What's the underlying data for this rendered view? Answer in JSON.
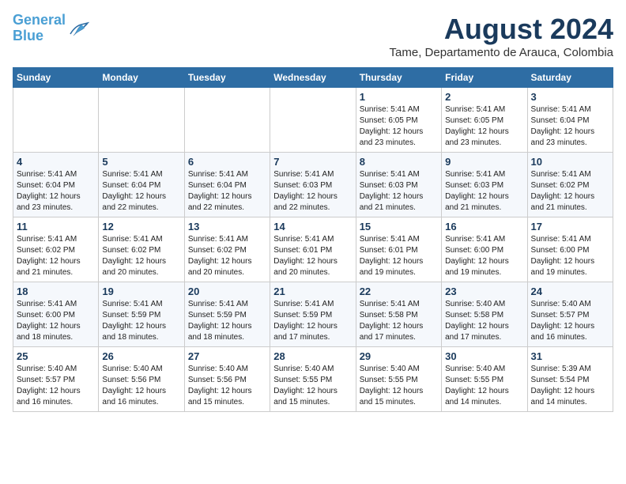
{
  "header": {
    "logo_line1": "General",
    "logo_line2": "Blue",
    "title": "August 2024",
    "subtitle": "Tame, Departamento de Arauca, Colombia"
  },
  "days_of_week": [
    "Sunday",
    "Monday",
    "Tuesday",
    "Wednesday",
    "Thursday",
    "Friday",
    "Saturday"
  ],
  "weeks": [
    [
      {
        "day": "",
        "info": ""
      },
      {
        "day": "",
        "info": ""
      },
      {
        "day": "",
        "info": ""
      },
      {
        "day": "",
        "info": ""
      },
      {
        "day": "1",
        "info": "Sunrise: 5:41 AM\nSunset: 6:05 PM\nDaylight: 12 hours\nand 23 minutes."
      },
      {
        "day": "2",
        "info": "Sunrise: 5:41 AM\nSunset: 6:05 PM\nDaylight: 12 hours\nand 23 minutes."
      },
      {
        "day": "3",
        "info": "Sunrise: 5:41 AM\nSunset: 6:04 PM\nDaylight: 12 hours\nand 23 minutes."
      }
    ],
    [
      {
        "day": "4",
        "info": "Sunrise: 5:41 AM\nSunset: 6:04 PM\nDaylight: 12 hours\nand 23 minutes."
      },
      {
        "day": "5",
        "info": "Sunrise: 5:41 AM\nSunset: 6:04 PM\nDaylight: 12 hours\nand 22 minutes."
      },
      {
        "day": "6",
        "info": "Sunrise: 5:41 AM\nSunset: 6:04 PM\nDaylight: 12 hours\nand 22 minutes."
      },
      {
        "day": "7",
        "info": "Sunrise: 5:41 AM\nSunset: 6:03 PM\nDaylight: 12 hours\nand 22 minutes."
      },
      {
        "day": "8",
        "info": "Sunrise: 5:41 AM\nSunset: 6:03 PM\nDaylight: 12 hours\nand 21 minutes."
      },
      {
        "day": "9",
        "info": "Sunrise: 5:41 AM\nSunset: 6:03 PM\nDaylight: 12 hours\nand 21 minutes."
      },
      {
        "day": "10",
        "info": "Sunrise: 5:41 AM\nSunset: 6:02 PM\nDaylight: 12 hours\nand 21 minutes."
      }
    ],
    [
      {
        "day": "11",
        "info": "Sunrise: 5:41 AM\nSunset: 6:02 PM\nDaylight: 12 hours\nand 21 minutes."
      },
      {
        "day": "12",
        "info": "Sunrise: 5:41 AM\nSunset: 6:02 PM\nDaylight: 12 hours\nand 20 minutes."
      },
      {
        "day": "13",
        "info": "Sunrise: 5:41 AM\nSunset: 6:02 PM\nDaylight: 12 hours\nand 20 minutes."
      },
      {
        "day": "14",
        "info": "Sunrise: 5:41 AM\nSunset: 6:01 PM\nDaylight: 12 hours\nand 20 minutes."
      },
      {
        "day": "15",
        "info": "Sunrise: 5:41 AM\nSunset: 6:01 PM\nDaylight: 12 hours\nand 19 minutes."
      },
      {
        "day": "16",
        "info": "Sunrise: 5:41 AM\nSunset: 6:00 PM\nDaylight: 12 hours\nand 19 minutes."
      },
      {
        "day": "17",
        "info": "Sunrise: 5:41 AM\nSunset: 6:00 PM\nDaylight: 12 hours\nand 19 minutes."
      }
    ],
    [
      {
        "day": "18",
        "info": "Sunrise: 5:41 AM\nSunset: 6:00 PM\nDaylight: 12 hours\nand 18 minutes."
      },
      {
        "day": "19",
        "info": "Sunrise: 5:41 AM\nSunset: 5:59 PM\nDaylight: 12 hours\nand 18 minutes."
      },
      {
        "day": "20",
        "info": "Sunrise: 5:41 AM\nSunset: 5:59 PM\nDaylight: 12 hours\nand 18 minutes."
      },
      {
        "day": "21",
        "info": "Sunrise: 5:41 AM\nSunset: 5:59 PM\nDaylight: 12 hours\nand 17 minutes."
      },
      {
        "day": "22",
        "info": "Sunrise: 5:41 AM\nSunset: 5:58 PM\nDaylight: 12 hours\nand 17 minutes."
      },
      {
        "day": "23",
        "info": "Sunrise: 5:40 AM\nSunset: 5:58 PM\nDaylight: 12 hours\nand 17 minutes."
      },
      {
        "day": "24",
        "info": "Sunrise: 5:40 AM\nSunset: 5:57 PM\nDaylight: 12 hours\nand 16 minutes."
      }
    ],
    [
      {
        "day": "25",
        "info": "Sunrise: 5:40 AM\nSunset: 5:57 PM\nDaylight: 12 hours\nand 16 minutes."
      },
      {
        "day": "26",
        "info": "Sunrise: 5:40 AM\nSunset: 5:56 PM\nDaylight: 12 hours\nand 16 minutes."
      },
      {
        "day": "27",
        "info": "Sunrise: 5:40 AM\nSunset: 5:56 PM\nDaylight: 12 hours\nand 15 minutes."
      },
      {
        "day": "28",
        "info": "Sunrise: 5:40 AM\nSunset: 5:55 PM\nDaylight: 12 hours\nand 15 minutes."
      },
      {
        "day": "29",
        "info": "Sunrise: 5:40 AM\nSunset: 5:55 PM\nDaylight: 12 hours\nand 15 minutes."
      },
      {
        "day": "30",
        "info": "Sunrise: 5:40 AM\nSunset: 5:55 PM\nDaylight: 12 hours\nand 14 minutes."
      },
      {
        "day": "31",
        "info": "Sunrise: 5:39 AM\nSunset: 5:54 PM\nDaylight: 12 hours\nand 14 minutes."
      }
    ]
  ]
}
